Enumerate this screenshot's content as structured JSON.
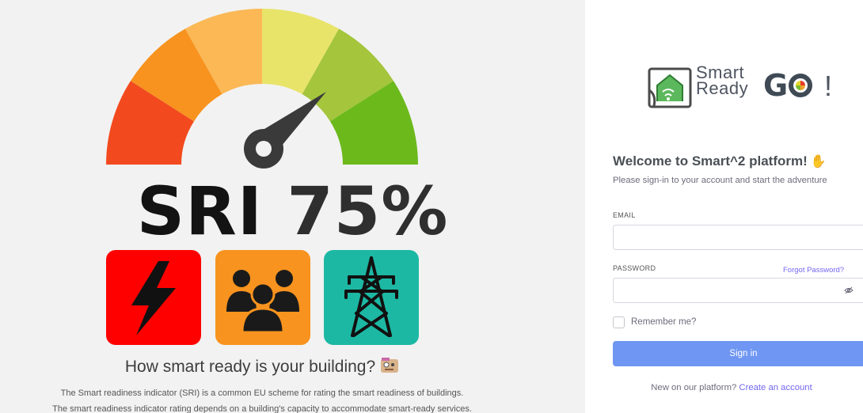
{
  "hero": {
    "sri_prefix": "SRI",
    "sri_value": "75%",
    "gauge_colors": [
      "#f24a1e",
      "#f7931e",
      "#fbb855",
      "#e8e46a",
      "#a4c53c",
      "#6cb91c"
    ],
    "needle_color": "#3a3a3a",
    "tiles": [
      {
        "name": "energy",
        "icon": "lightning-bolt-icon",
        "color": "#ff0000"
      },
      {
        "name": "occupants",
        "icon": "people-group-icon",
        "color": "#f7931e"
      },
      {
        "name": "grid",
        "icon": "power-tower-icon",
        "color": "#1db8a3"
      }
    ],
    "question": "How smart ready is your building?",
    "question_emoji": "face-with-monocle-icon",
    "description_line1": "The Smart readiness indicator (SRI) is a common EU scheme for rating the smart readiness of buildings.",
    "description_line2": "The smart readiness indicator rating depends on a building's capacity to accommodate smart-ready services."
  },
  "logo": {
    "line1": "Smart",
    "line2": "Ready",
    "go_letter": "G",
    "exclamation": "!",
    "icon": "smart-home-icon"
  },
  "login": {
    "welcome": "Welcome to Smart^2 platform!",
    "welcome_emoji": "waving-hand-icon",
    "subtitle": "Please sign-in to your account and start the adventure",
    "email_label": "EMAIL",
    "email_value": "",
    "password_label": "PASSWORD",
    "password_value": "",
    "forgot_link": "Forgot Password?",
    "remember_label": "Remember me?",
    "signin_label": "Sign in",
    "new_text": "New on our platform?",
    "create_link": "Create an account",
    "accent_color": "#7367f0",
    "button_color": "#6e96f2"
  }
}
